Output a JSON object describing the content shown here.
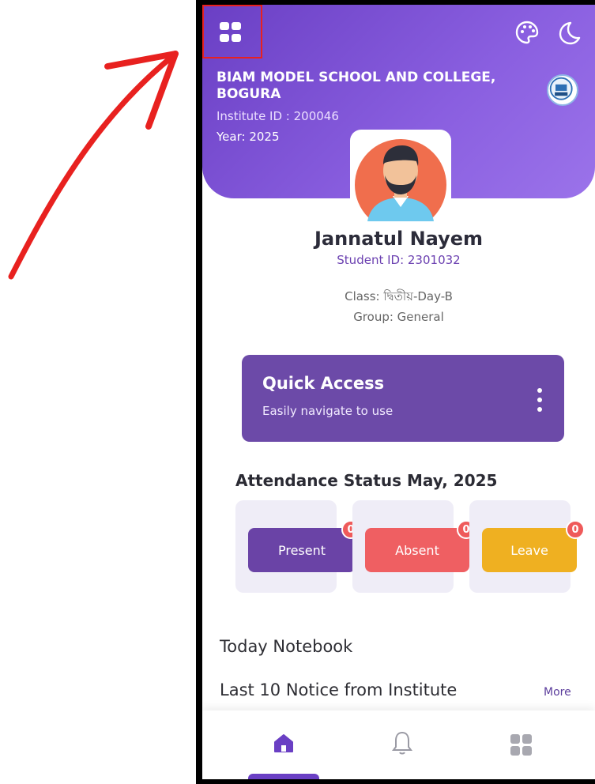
{
  "header": {
    "school_name": "BIAM MODEL SCHOOL AND COLLEGE, BOGURA",
    "institute_id": "Institute ID : 200046",
    "year": "Year: 2025",
    "icons": [
      "menu-grid-icon",
      "palette-icon",
      "moon-icon"
    ]
  },
  "profile": {
    "name": "Jannatul Nayem",
    "student_id": "Student ID: 2301032",
    "class": "Class: দ্বিতীয়-Day-B",
    "group": "Group: General"
  },
  "quick_access": {
    "title": "Quick Access",
    "subtitle": "Easily navigate to use"
  },
  "attendance": {
    "title": "Attendance Status May, 2025",
    "items": [
      {
        "label": "Present",
        "count": "0",
        "color": "#6a43a6"
      },
      {
        "label": "Absent",
        "count": "0",
        "color": "#ef5f62"
      },
      {
        "label": "Leave",
        "count": "0",
        "color": "#efb021"
      }
    ]
  },
  "sections": {
    "notebook": "Today Notebook",
    "notice": "Last 10 Notice from Institute",
    "more": "More"
  },
  "bottom_nav": {
    "items": [
      "home-icon",
      "bell-icon",
      "grid-icon"
    ],
    "active": "home"
  },
  "colors": {
    "accent": "#6a3fc4",
    "highlight_box": "#e8211f"
  }
}
